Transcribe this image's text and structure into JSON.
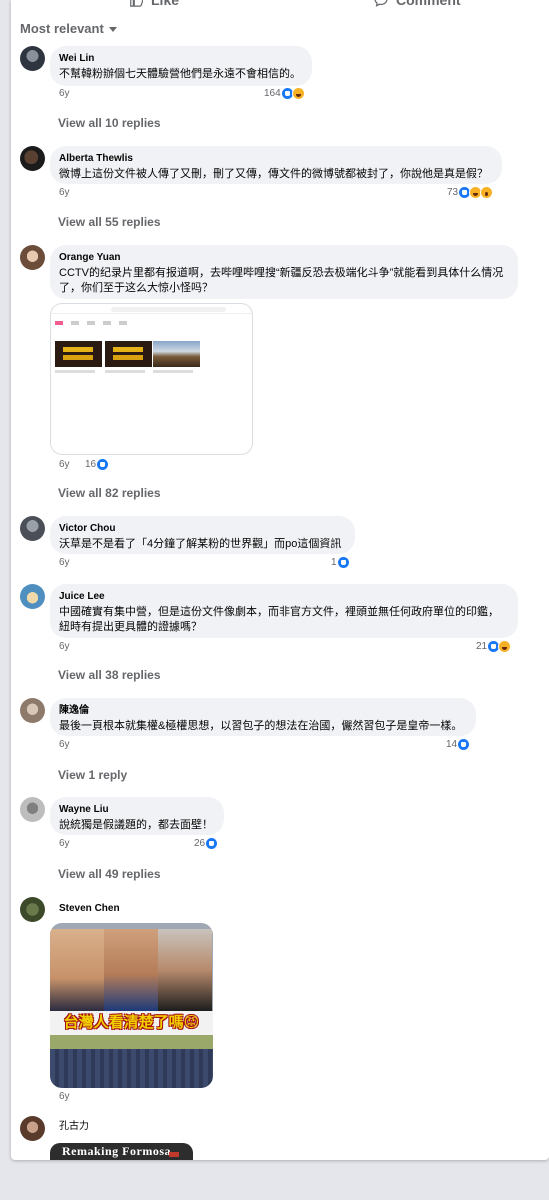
{
  "actions": {
    "like": "Like",
    "comment": "Comment"
  },
  "sort_label": "Most relevant",
  "comments": [
    {
      "author": "Wei Lin",
      "text": "不幫韓粉辦個七天體驗營他們是永遠不會相信的。",
      "time": "6y",
      "reactions": "164",
      "reaction_icons": [
        "like",
        "haha"
      ],
      "replies": "View all 10 replies"
    },
    {
      "author": "Alberta Thewlis",
      "text": "微博上這份文件被人傳了又刪，刪了又傳，傳文件的微博號都被封了，你說他是真是假？",
      "time": "6y",
      "reactions": "73",
      "reaction_icons": [
        "like",
        "haha",
        "wow"
      ],
      "replies": "View all 55 replies"
    },
    {
      "author": "Orange Yuan",
      "text": "CCTV的纪录片里都有报道啊，去哔哩哔哩搜“新疆反恐去极端化斗争”就能看到具体什么情况了，你们至于这么大惊小怪吗？",
      "time": "6y",
      "reactions": "16",
      "reaction_icons": [
        "like"
      ],
      "replies": "View all 82 replies"
    },
    {
      "author": "Victor Chou",
      "text": "沃草是不是看了「4分鐘了解某粉的世界觀」而po這個資訊",
      "time": "6y",
      "reactions": "1",
      "reaction_icons": [
        "like"
      ]
    },
    {
      "author": "Juice Lee",
      "text": "中國確實有集中營，但是這份文件像劇本，而非官方文件，裡頭並無任何政府單位的印鑑，紐時有提出更具體的證據嗎？",
      "time": "6y",
      "reactions": "21",
      "reaction_icons": [
        "like",
        "haha"
      ],
      "replies": "View all 38 replies"
    },
    {
      "author": "陳逸倫",
      "text": "最後一頁根本就集權&極權思想，以習包子的想法在治國，儼然習包子是皇帝一樣。",
      "time": "6y",
      "reactions": "14",
      "reaction_icons": [
        "like"
      ],
      "replies": "View 1 reply"
    },
    {
      "author": "Wayne Liu",
      "text": "說統獨是假議題的，都去面壁！",
      "time": "6y",
      "reactions": "26",
      "reaction_icons": [
        "like"
      ],
      "replies": "View all 49 replies"
    },
    {
      "author": "Steven Chen",
      "time": "6y",
      "meme_caption": "台灣人看清楚了嗎😡"
    },
    {
      "author": "孔古力",
      "image_text": "Remaking Formosa"
    }
  ],
  "colors": {
    "accent": "#1877f2",
    "muted": "#65676b",
    "bubble": "#f0f2f5"
  }
}
